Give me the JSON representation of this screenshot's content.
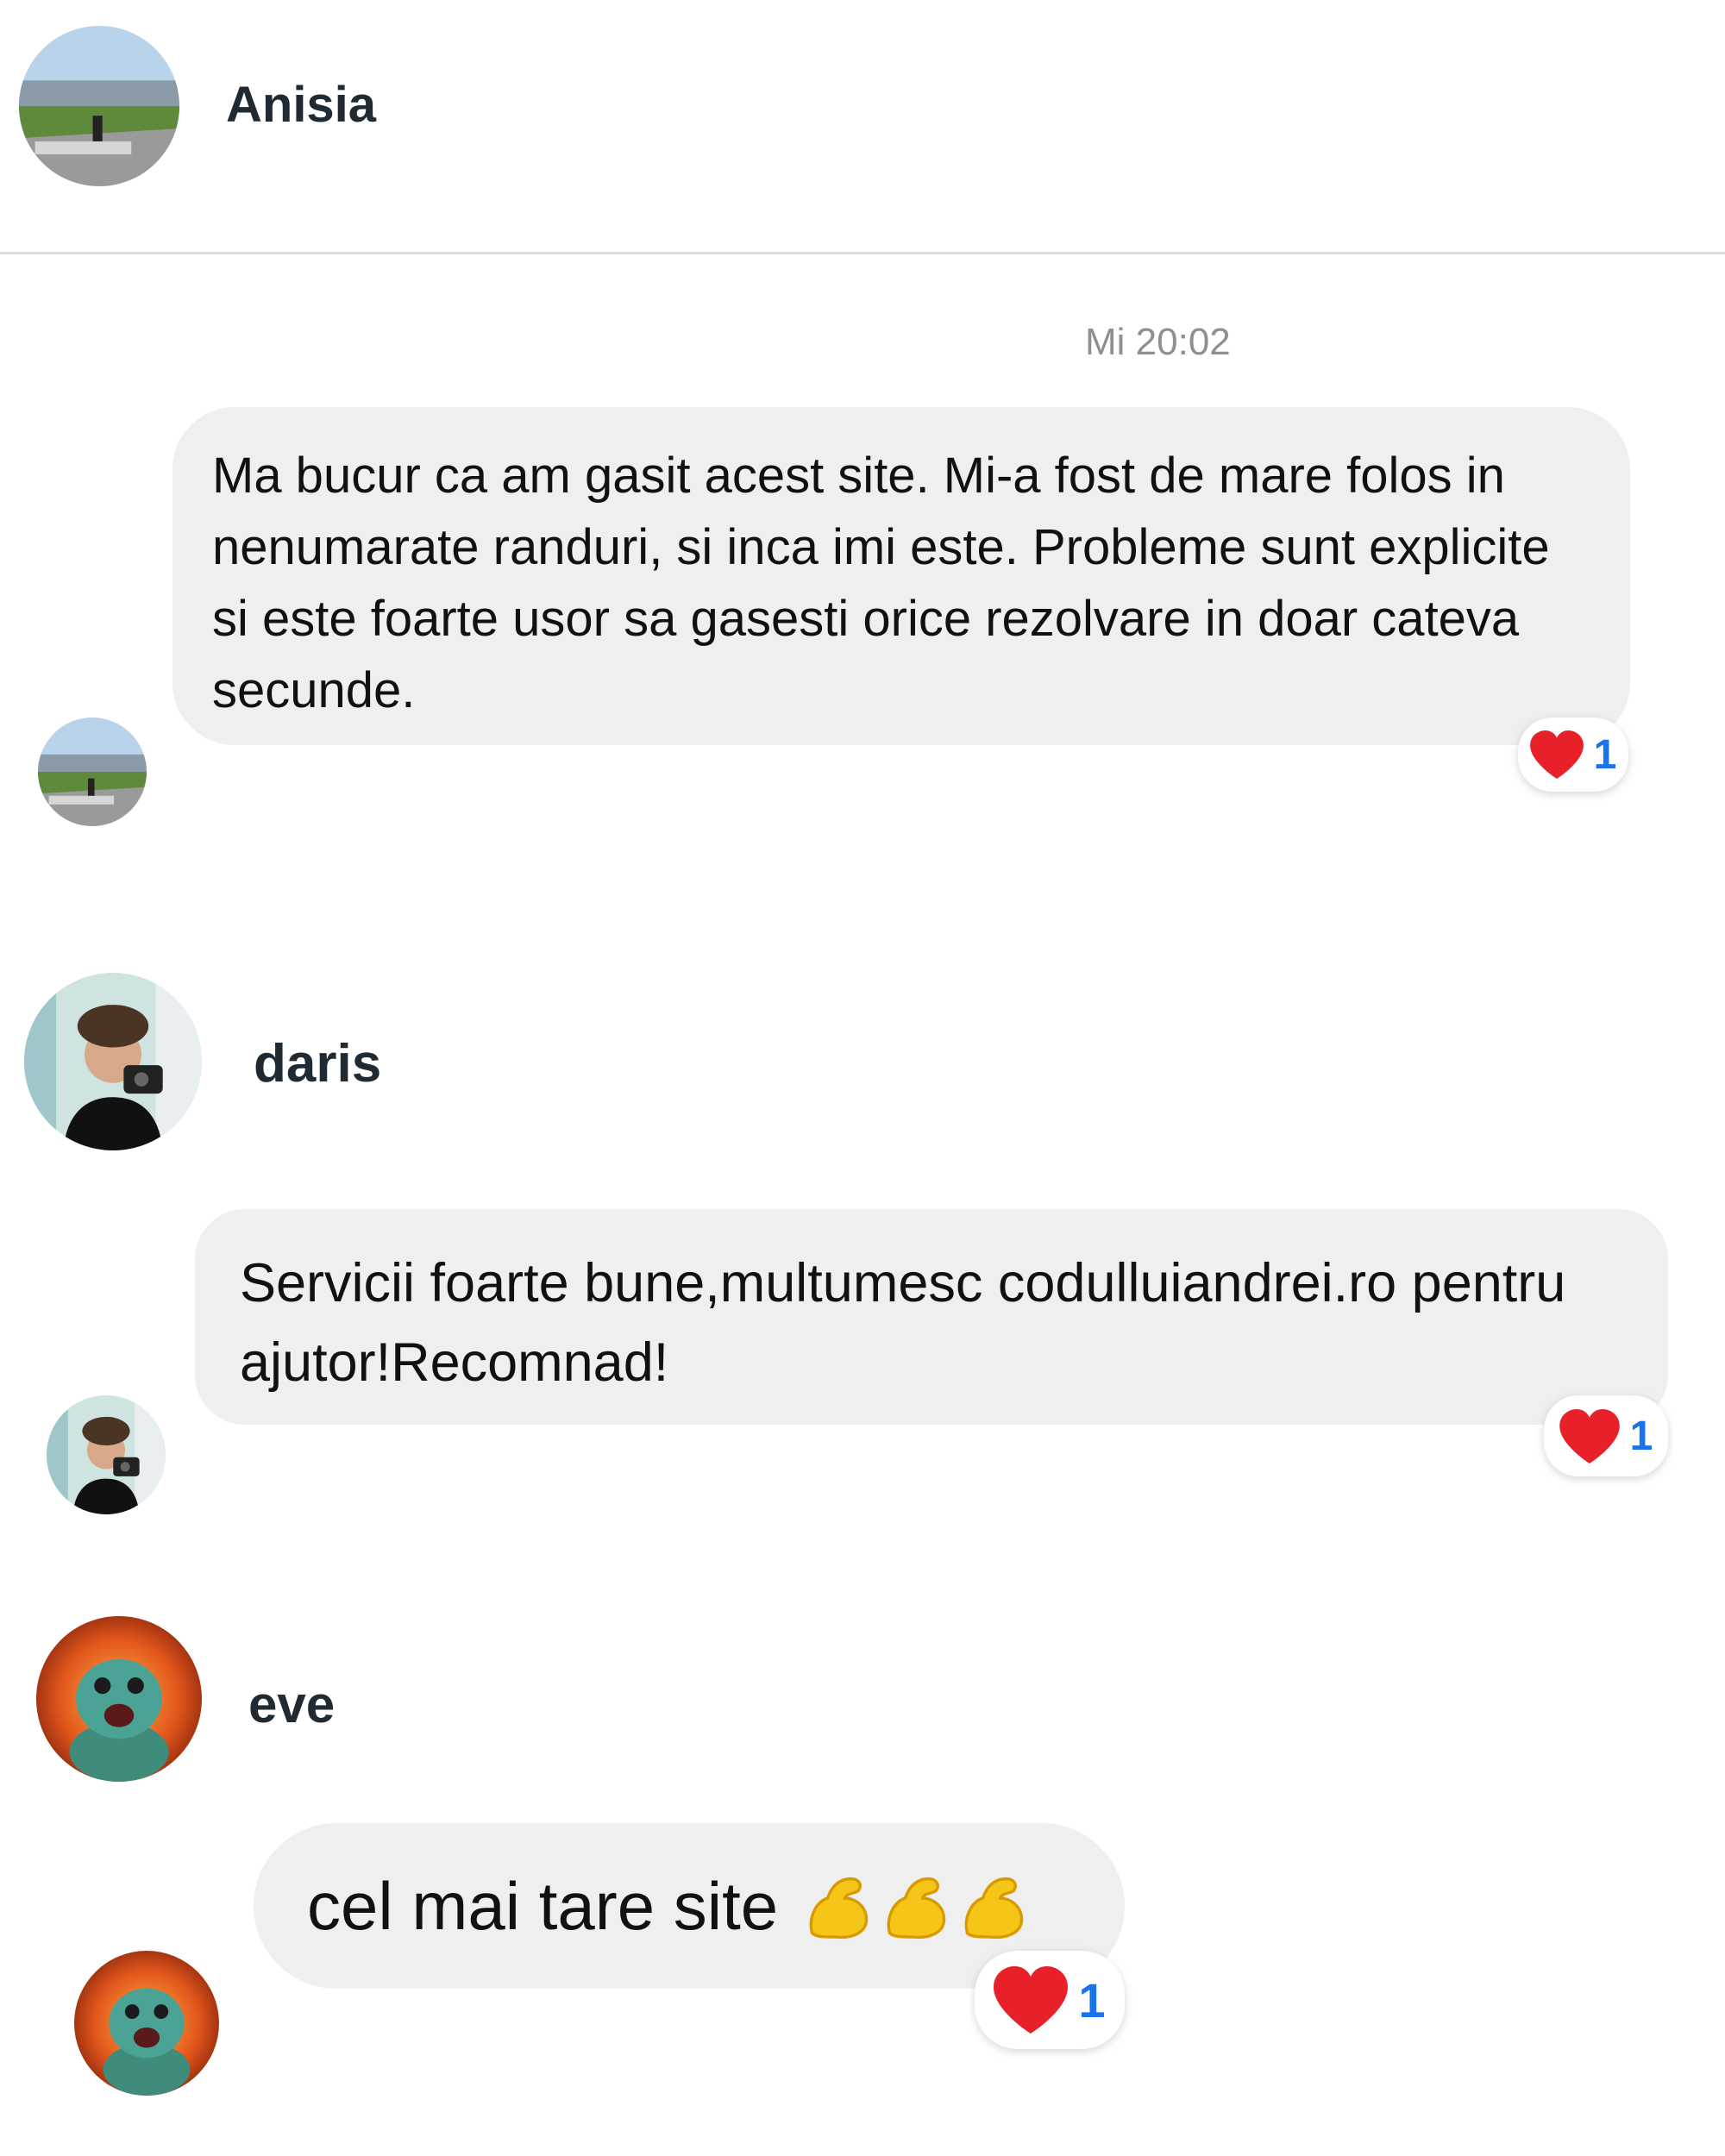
{
  "header": {
    "name": "Anisia"
  },
  "timestamp": "Mi 20:02",
  "messages": [
    {
      "text": "Ma bucur ca am gasit acest site. Mi-a fost de mare folos in nenumarate randuri, si inca imi este. Probleme sunt explicite si este foarte usor sa gasesti orice rezolvare in doar cateva secunde.",
      "reaction_count": "1",
      "reaction_icon": "heart-icon"
    },
    {
      "sender": "daris",
      "text": "Servicii foarte bune,multumesc codulluiandrei.ro pentru ajutor!Recomnad!",
      "reaction_count": "1",
      "reaction_icon": "heart-icon"
    },
    {
      "sender": "eve",
      "text": "cel mai tare site",
      "emojis": [
        "flexed-biceps-icon",
        "flexed-biceps-icon",
        "flexed-biceps-icon"
      ],
      "reaction_count": "1",
      "reaction_icon": "heart-icon"
    }
  ],
  "colors": {
    "bubble": "#efefef",
    "reaction_count": "#1a73e8",
    "heart": "#e8202a",
    "divider": "#dcdcdc"
  }
}
